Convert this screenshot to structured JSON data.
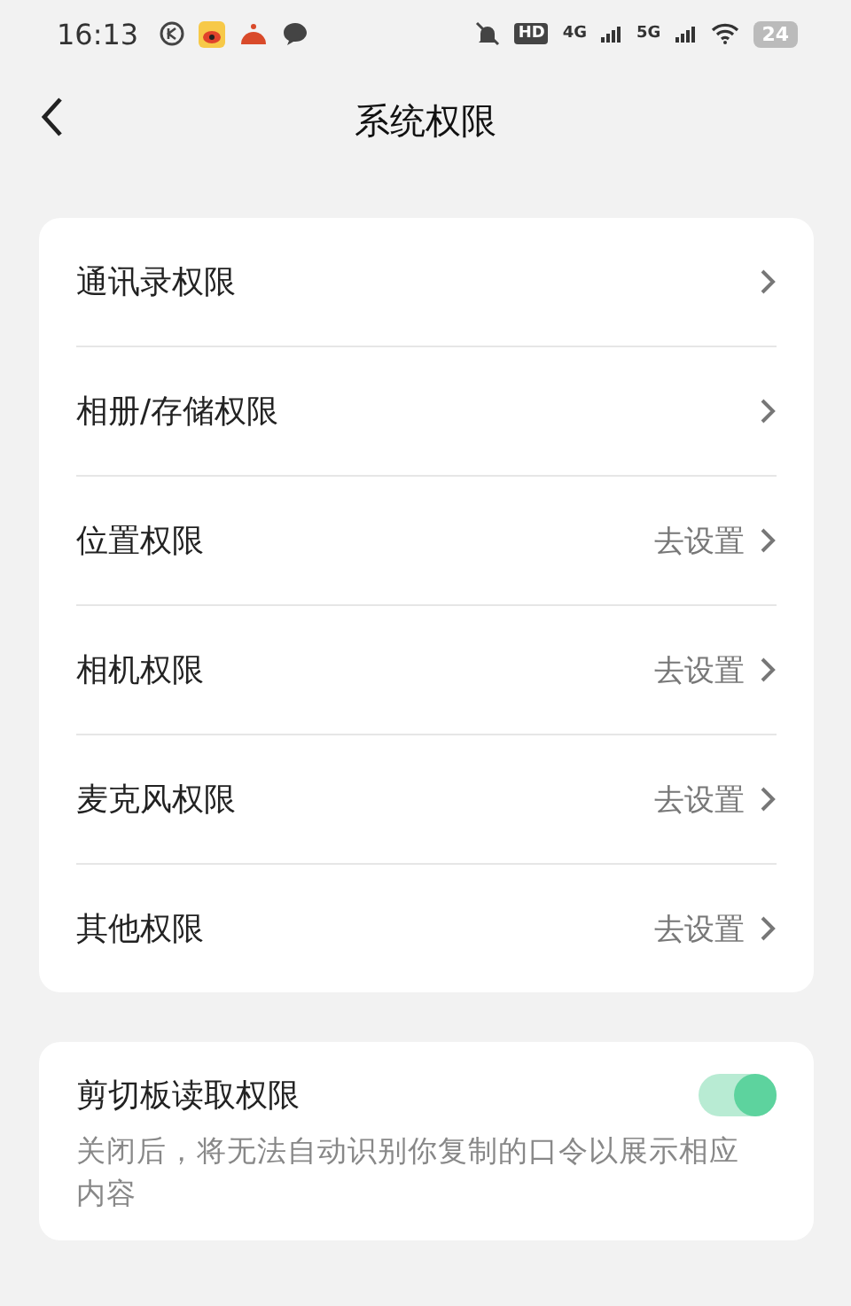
{
  "status_bar": {
    "time": "16:13",
    "hd": "HD",
    "network_1": "4G",
    "network_2": "5G",
    "battery": "24"
  },
  "header": {
    "title": "系统权限"
  },
  "permissions": [
    {
      "label": "通讯录权限"
    },
    {
      "label": "相册/存储权限"
    },
    {
      "label": "位置权限",
      "action": "去设置"
    },
    {
      "label": "相机权限",
      "action": "去设置"
    },
    {
      "label": "麦克风权限",
      "action": "去设置"
    },
    {
      "label": "其他权限",
      "action": "去设置"
    }
  ],
  "clipboard": {
    "title": "剪切板读取权限",
    "on": true,
    "description": "关闭后，将无法自动识别你复制的口令以展示相应内容"
  }
}
